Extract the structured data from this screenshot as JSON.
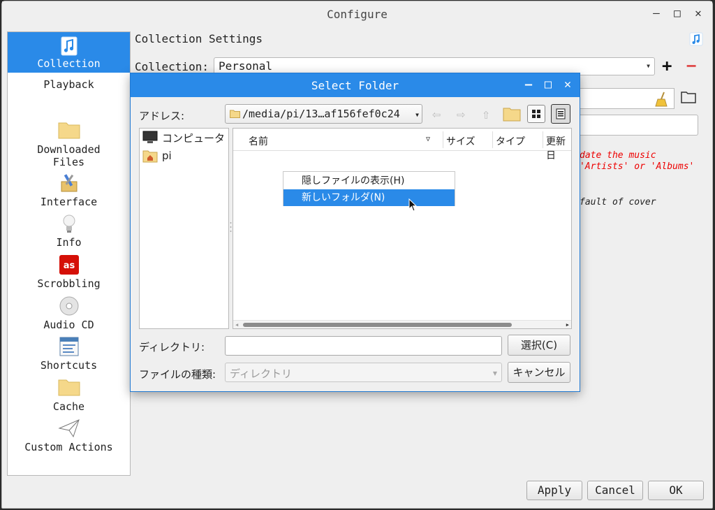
{
  "window": {
    "title": "Configure",
    "controls": [
      "–",
      "□",
      "✕"
    ]
  },
  "sidebar": {
    "items": [
      {
        "label": "Collection",
        "icon": "music-note-icon"
      },
      {
        "label": "Playback",
        "icon": "none"
      },
      {
        "label": "Downloaded\nFiles",
        "icon": "folder-icon"
      },
      {
        "label": "Interface",
        "icon": "tools-icon"
      },
      {
        "label": "Info",
        "icon": "lightbulb-icon"
      },
      {
        "label": "Scrobbling",
        "icon": "lastfm-icon"
      },
      {
        "label": "Audio CD",
        "icon": "cd-icon"
      },
      {
        "label": "Shortcuts",
        "icon": "shortcuts-icon"
      },
      {
        "label": "Cache",
        "icon": "folder-icon"
      },
      {
        "label": "Custom Actions",
        "icon": "paper-plane-icon"
      }
    ]
  },
  "settings": {
    "title": "Collection Settings",
    "collection_label": "Collection:",
    "collection_value": "Personal",
    "notes": {
      "line1": "date the music",
      "line2": "'Artists' or 'Albums'",
      "line3": "fault of cover"
    }
  },
  "buttons": {
    "apply": "Apply",
    "cancel": "Cancel",
    "ok": "OK"
  },
  "dialog": {
    "title": "Select Folder",
    "address_label": "アドレス:",
    "address_value": "/media/pi/13…af156fef0c24",
    "places": [
      {
        "label": "コンピュータ",
        "icon": "computer-icon"
      },
      {
        "label": "pi",
        "icon": "home-folder-icon"
      }
    ],
    "columns": [
      "名前",
      "サイズ",
      "タイプ",
      "更新日"
    ],
    "context_menu": [
      "隠しファイルの表示(H)",
      "新しいフォルダ(N)"
    ],
    "directory_label": "ディレクトリ:",
    "directory_value": "",
    "filetype_label": "ファイルの種類:",
    "filetype_value": "ディレクトリ",
    "select_button": "選択(C)",
    "cancel_button": "キャンセル"
  },
  "colors": {
    "accent": "#2a8ae8",
    "warning_text": "#e00000"
  }
}
